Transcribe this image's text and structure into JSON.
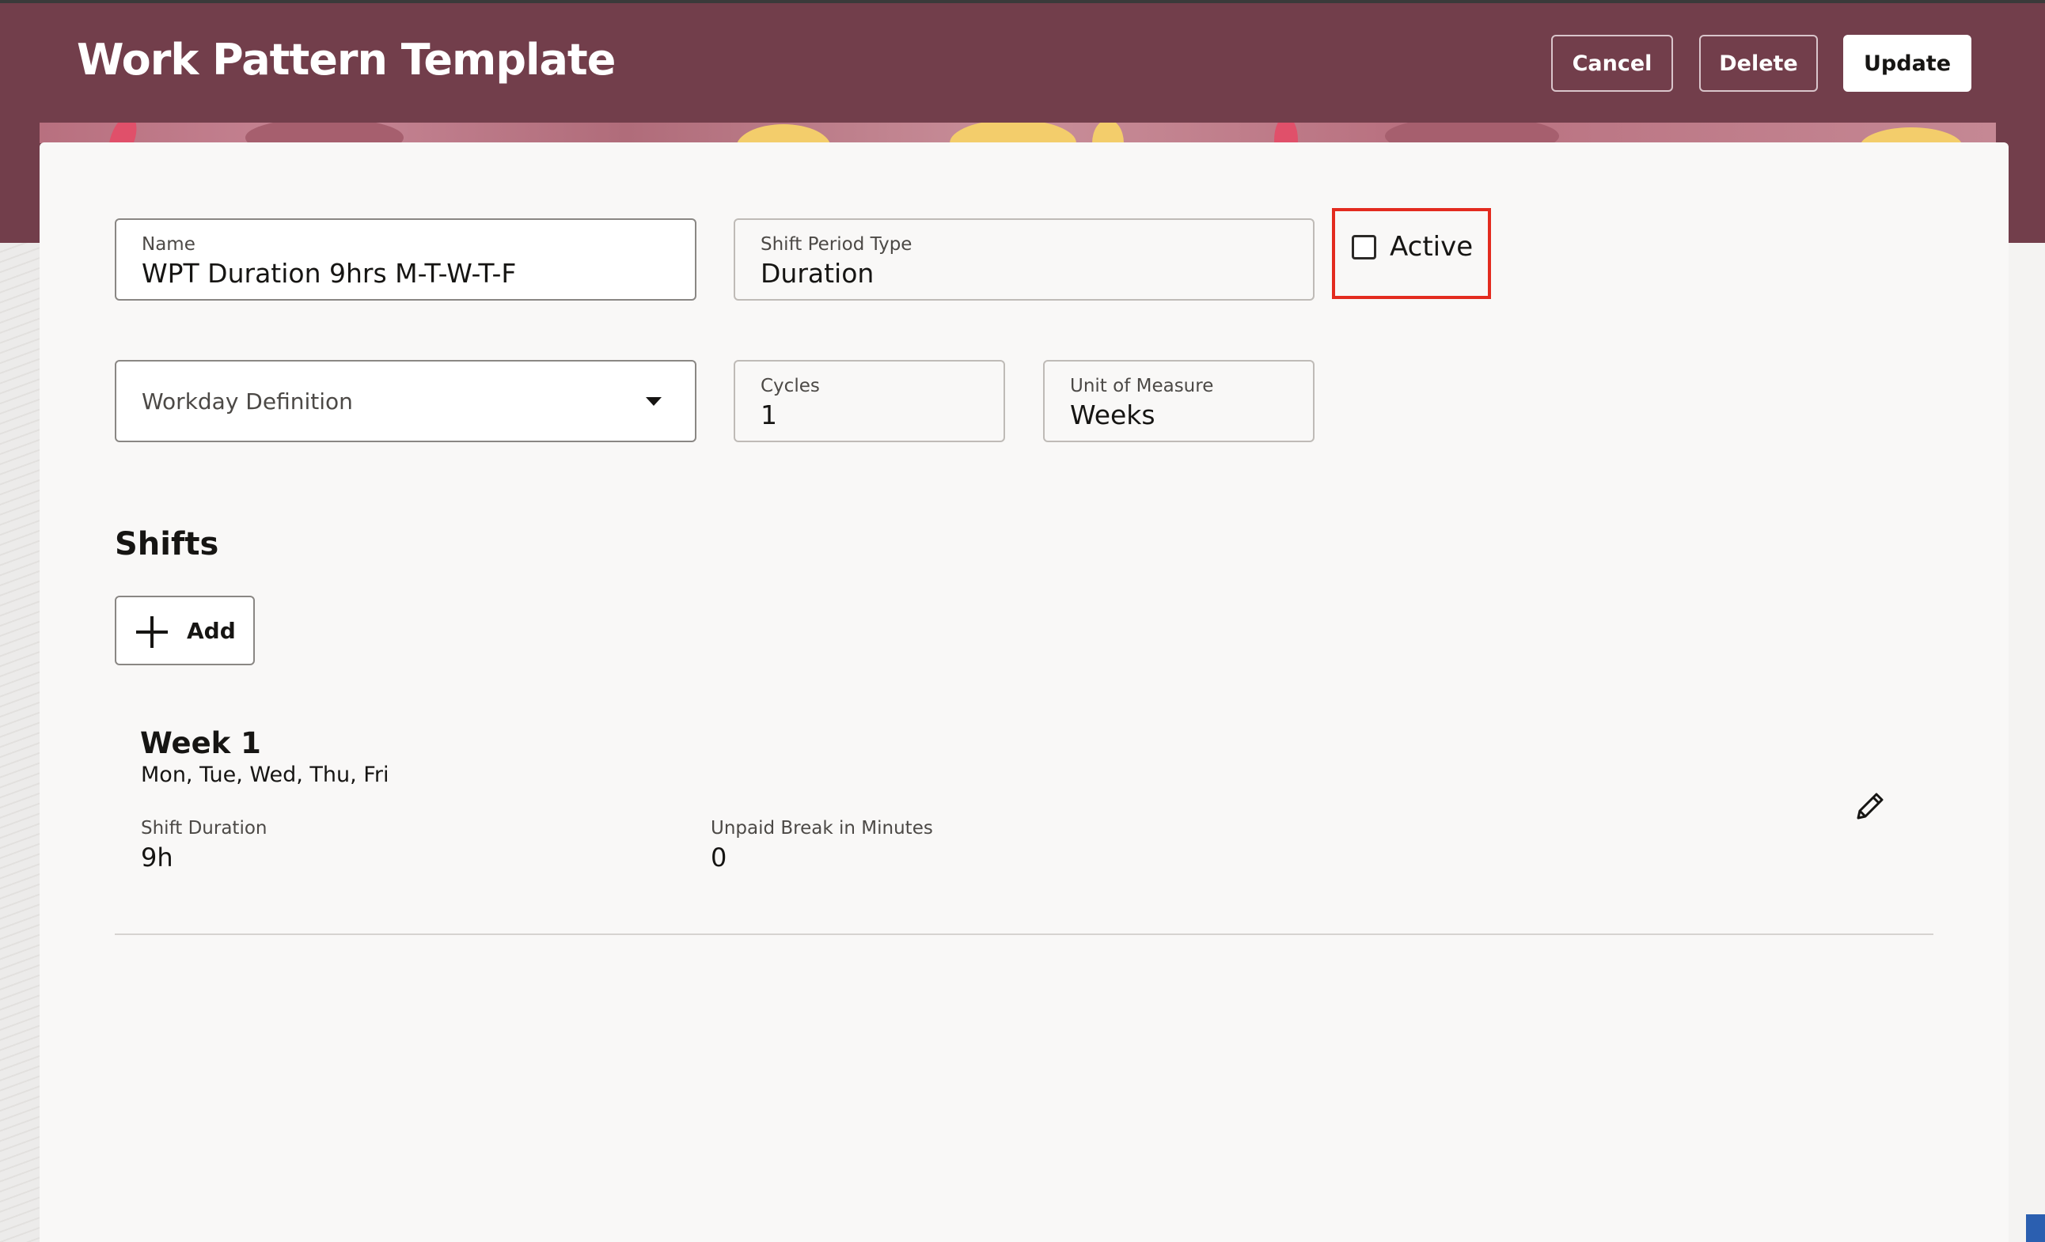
{
  "header": {
    "title": "Work Pattern Template",
    "buttons": {
      "cancel": "Cancel",
      "delete": "Delete",
      "update": "Update"
    }
  },
  "form": {
    "name": {
      "label": "Name",
      "value": "WPT Duration 9hrs M-T-W-T-F"
    },
    "shift_period_type": {
      "label": "Shift Period Type",
      "value": "Duration"
    },
    "active": {
      "label": "Active",
      "checked": false
    },
    "workday_definition": {
      "placeholder": "Workday Definition"
    },
    "cycles": {
      "label": "Cycles",
      "value": "1"
    },
    "unit_of_measure": {
      "label": "Unit of Measure",
      "value": "Weeks"
    }
  },
  "shifts": {
    "title": "Shifts",
    "add_label": "Add",
    "items": [
      {
        "title": "Week 1",
        "days": "Mon, Tue, Wed, Thu, Fri",
        "shift_duration_label": "Shift Duration",
        "shift_duration_value": "9h",
        "unpaid_break_label": "Unpaid Break in Minutes",
        "unpaid_break_value": "0"
      }
    ]
  },
  "colors": {
    "header_bg": "#723e4b",
    "highlight": "#e32b1f",
    "card_bg": "#f9f8f7"
  }
}
